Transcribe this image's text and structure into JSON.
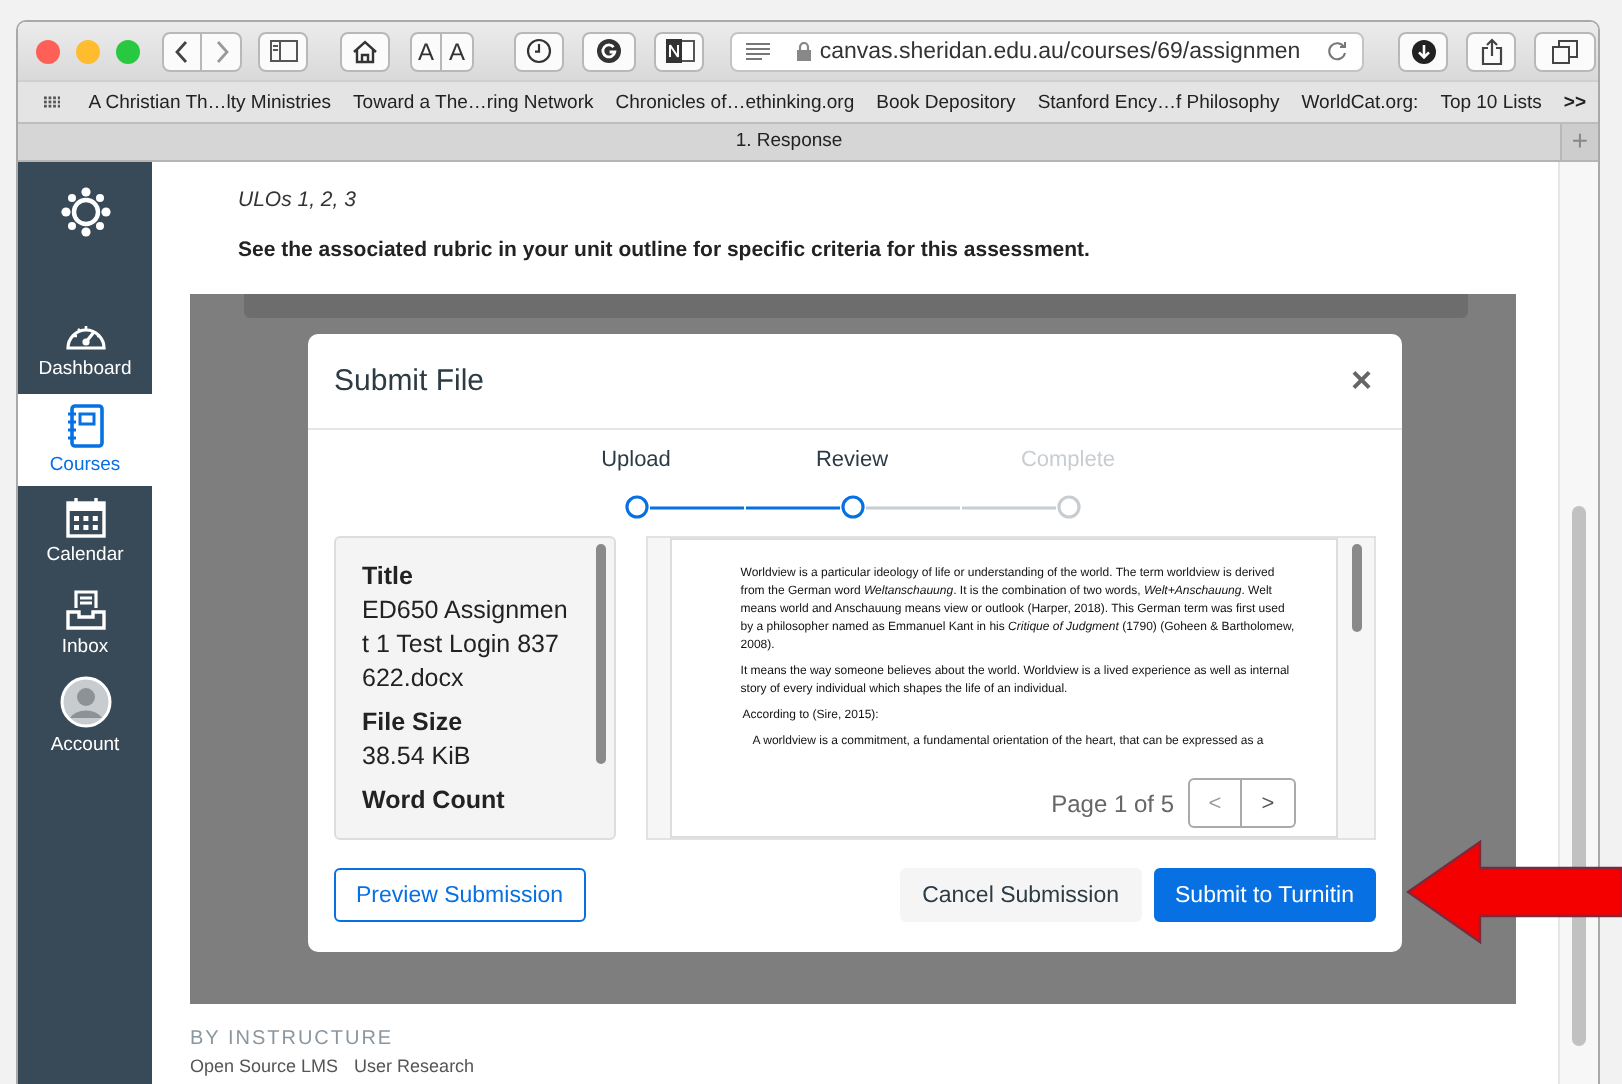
{
  "browser": {
    "text_size_buttons": [
      "A",
      "A"
    ],
    "address": {
      "url": "canvas.sheridan.edu.au/courses/69/assignmen"
    },
    "bookmarks": [
      "A Christian Th…lty Ministries",
      "Toward a The…ring Network",
      "Chronicles of…ethinking.org",
      "Book Depository",
      "Stanford Ency…f Philosophy",
      "WorldCat.org:",
      "Top 10 Lists"
    ],
    "bookmarks_more": ">>",
    "tab": {
      "title": "1. Response"
    },
    "new_tab": "+"
  },
  "sidebar": {
    "items": [
      {
        "kind": "dashboard",
        "label": "Dashboard",
        "selected": false
      },
      {
        "kind": "courses",
        "label": "Courses",
        "selected": true
      },
      {
        "kind": "calendar",
        "label": "Calendar",
        "selected": false
      },
      {
        "kind": "inbox",
        "label": "Inbox",
        "selected": false
      },
      {
        "kind": "account",
        "label": "Account",
        "selected": false
      }
    ]
  },
  "page": {
    "ulos": "ULOs 1, 2, 3",
    "rubric_note": "See the associated rubric in your unit outline for specific criteria for this assessment."
  },
  "modal": {
    "title": "Submit File",
    "close": "×",
    "steps": [
      {
        "label": "Upload",
        "reached": true
      },
      {
        "label": "Review",
        "reached": true
      },
      {
        "label": "Complete",
        "reached": false
      }
    ],
    "file_info": [
      {
        "label": "Title",
        "value": "ED650 Assignment 1 Test Login 837622.docx"
      },
      {
        "label": "File Size",
        "value": "38.54 KiB"
      },
      {
        "label": "Word Count"
      }
    ],
    "document": [
      {
        "kind": "body",
        "text": "Worldview is a particular ideology of life or understanding of the world. The term worldview is derived from the German word *Weltanschauung*. It is the combination of two words, *Welt+Anschauung*. Welt means world and Anschauung means view or outlook (Harper, 2018). This German term was first used by a philosopher named as Emmanuel Kant in his *Critique of Judgment* (1790) (Goheen & Bartholomew, 2008)."
      },
      {
        "kind": "body",
        "text": "It means the way someone believes about the world. Worldview is a lived experience as well as internal story of every individual which shapes the life of an individual."
      },
      {
        "kind": "label",
        "text": "According to (Sire, 2015):"
      },
      {
        "kind": "quote",
        "text": "A worldview is a commitment, a fundamental orientation of the heart, that can be expressed as a"
      }
    ],
    "pager": {
      "text": "Page 1 of 5",
      "prev": "<",
      "next": ">"
    },
    "buttons": {
      "preview": "Preview Submission",
      "cancel": "Cancel Submission",
      "submit": "Submit to Turnitin"
    }
  },
  "footer": {
    "brand": "BY INSTRUCTURE",
    "links": [
      "Open Source LMS",
      "User Research"
    ]
  }
}
